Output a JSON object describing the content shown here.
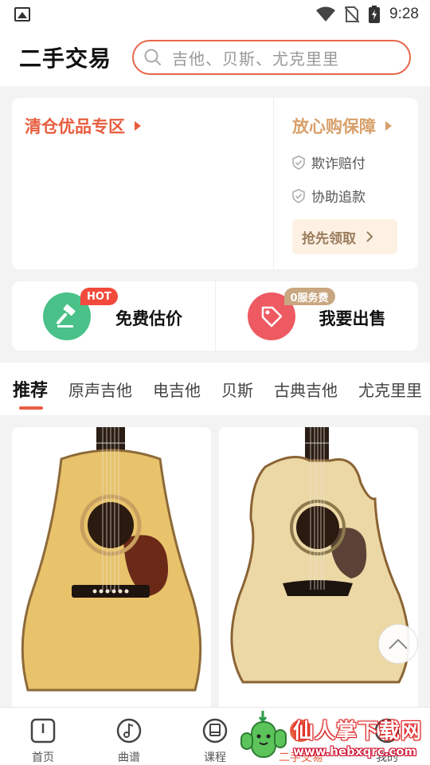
{
  "status_bar": {
    "time": "9:28"
  },
  "header": {
    "title": "二手交易",
    "search_placeholder": "吉他、贝斯、尤克里里"
  },
  "promo": {
    "left_title": "清仓优品专区",
    "right_title": "放心购保障",
    "guarantees": [
      "欺诈赔付",
      "协助追款"
    ],
    "claim_label": "抢先领取"
  },
  "actions": [
    {
      "label": "免费估价",
      "badge": "HOT",
      "icon": "gavel-icon"
    },
    {
      "label": "我要出售",
      "badge": "0服务费",
      "icon": "price-tag-icon"
    }
  ],
  "tabs": [
    "推荐",
    "原声吉他",
    "电吉他",
    "贝斯",
    "古典吉他",
    "尤克里里"
  ],
  "active_tab": "推荐",
  "products": [
    {
      "image": "dreadnought-acoustic-guitar"
    },
    {
      "image": "cutaway-acoustic-guitar"
    }
  ],
  "bottom_nav": [
    {
      "label": "首页",
      "icon": "home-icon"
    },
    {
      "label": "曲谱",
      "icon": "music-note-icon"
    },
    {
      "label": "课程",
      "icon": "course-book-icon"
    },
    {
      "label": "二手交易",
      "icon": "trade-icon",
      "active": true
    },
    {
      "label": "我的",
      "icon": "profile-icon"
    }
  ],
  "watermark": {
    "title": "仙人掌下载网",
    "url": "www.hebxqrc.com"
  },
  "colors": {
    "accent": "#e85d3f",
    "gold": "#d8a06a",
    "green": "#49c188",
    "red": "#ee5a62"
  }
}
